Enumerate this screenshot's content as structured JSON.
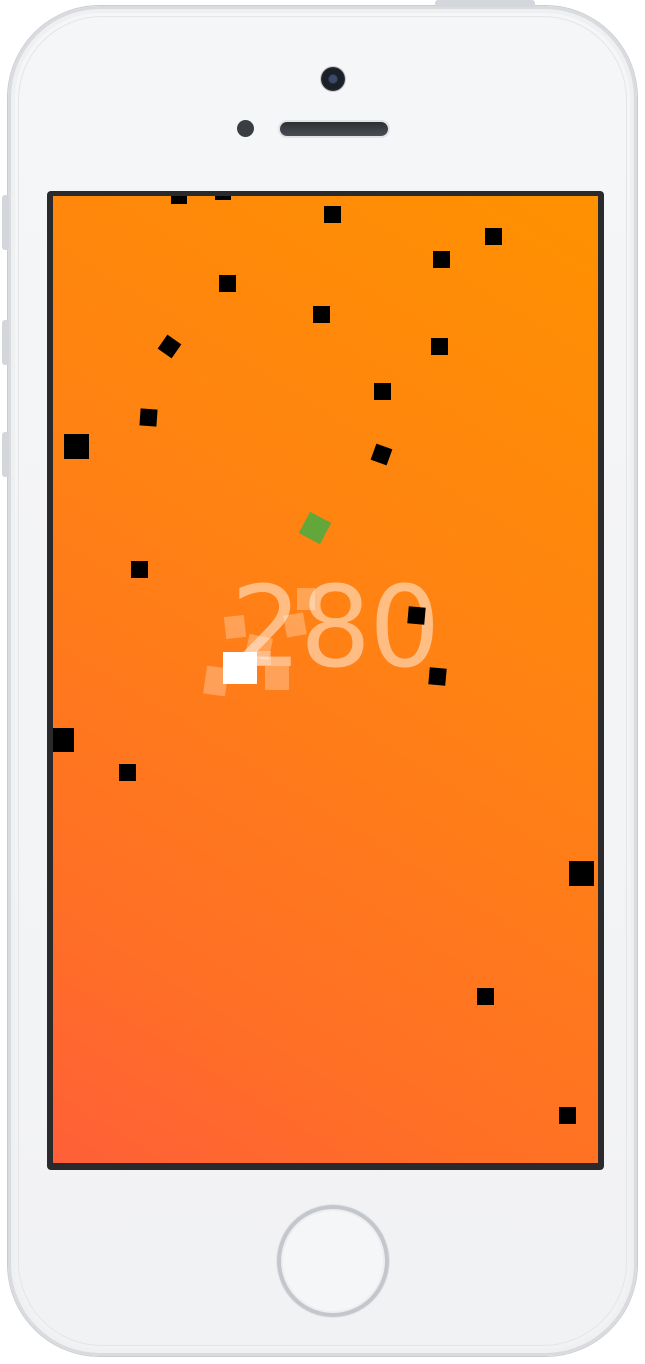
{
  "game": {
    "score": "280",
    "colors": {
      "background_top": "#ff9100",
      "background_bottom": "#ff5f38",
      "obstacle": "#000000",
      "target": "#63a63a",
      "player": "#ffffff"
    }
  },
  "device": {
    "icons": [
      "front-camera-icon",
      "proximity-sensor-icon",
      "earpiece-speaker-icon",
      "home-button-icon"
    ]
  }
}
